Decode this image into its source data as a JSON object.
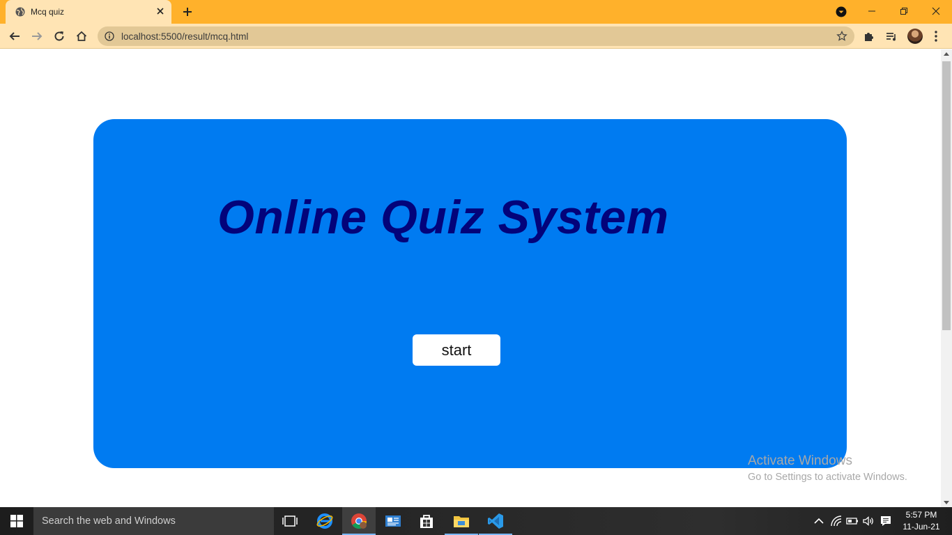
{
  "browser": {
    "tab_title": "Mcq quiz",
    "url": "localhost:5500/result/mcq.html"
  },
  "page": {
    "title": "Online Quiz System",
    "start_label": "start"
  },
  "watermark": {
    "line1": "Activate Windows",
    "line2": "Go to Settings to activate Windows."
  },
  "taskbar": {
    "search_placeholder": "Search the web and Windows",
    "time": "5:57 PM",
    "date": "11-Jun-21",
    "apps": [
      "task-view",
      "internet-explorer",
      "chrome",
      "news",
      "store",
      "file-explorer",
      "vscode"
    ]
  },
  "colors": {
    "titlebar": "#ffb12b",
    "card": "#007bf1",
    "title_text": "#03037a"
  }
}
